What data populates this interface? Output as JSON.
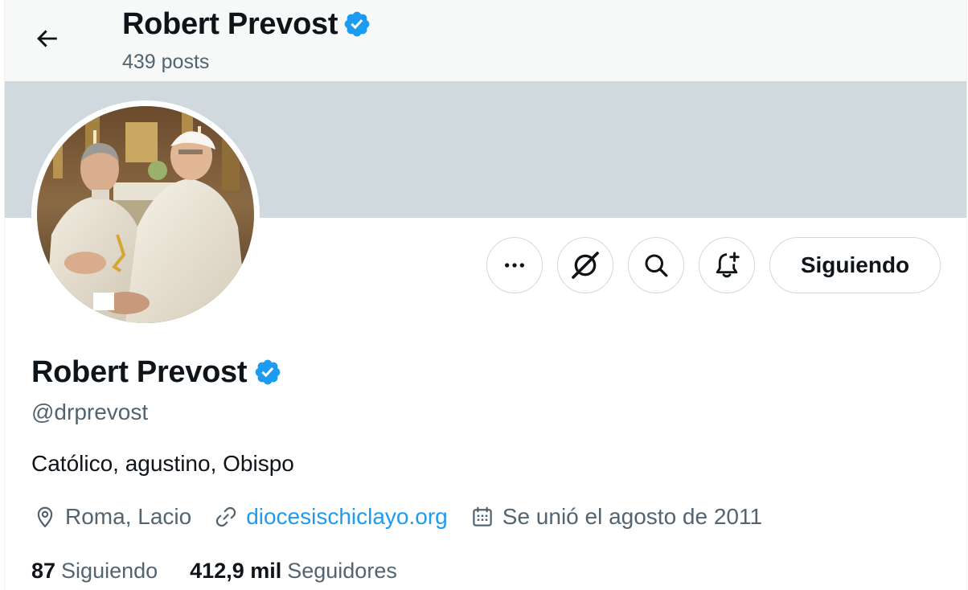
{
  "header": {
    "name": "Robert Prevost",
    "posts_count": "439 posts"
  },
  "actions": {
    "following_label": "Siguiendo"
  },
  "profile": {
    "name": "Robert Prevost",
    "handle": "@drprevost",
    "bio": "Católico, agustino, Obispo",
    "location": "Roma, Lacio",
    "website": "diocesischiclayo.org",
    "joined": "Se unió el agosto de 2011"
  },
  "stats": {
    "following_count": "87",
    "following_label": "Siguiendo",
    "followers_count": "412,9 mil",
    "followers_label": "Seguidores"
  },
  "icons": {
    "back": "arrow-left-icon",
    "verified": "verified-badge-icon",
    "more": "more-horizontal-icon",
    "grok": "grok-icon",
    "search": "search-icon",
    "notify": "bell-plus-icon",
    "location": "location-pin-icon",
    "link": "link-icon",
    "calendar": "calendar-icon"
  },
  "colors": {
    "accent": "#1d9bf0",
    "banner": "#cfd9de",
    "secondary_text": "#536471",
    "primary_text": "#0f1419"
  }
}
